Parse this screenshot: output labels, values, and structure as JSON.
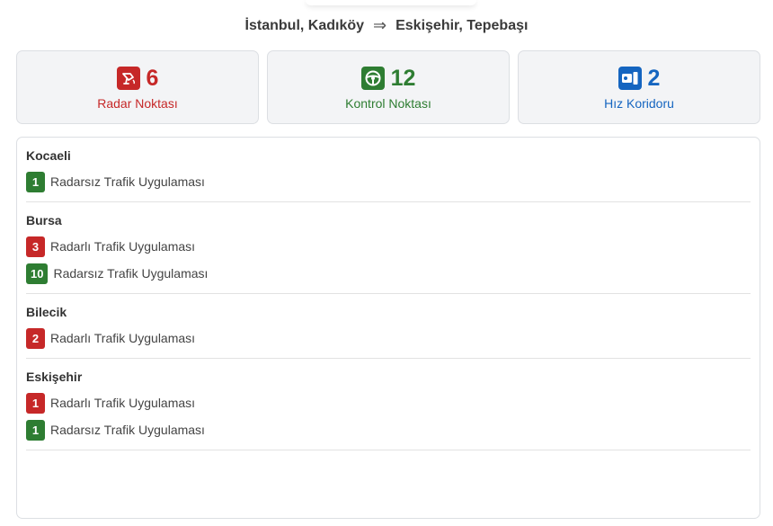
{
  "route": {
    "from": "İstanbul, Kadıköy",
    "arrow": "⇒",
    "to": "Eskişehir, Tepebaşı"
  },
  "colors": {
    "red": "#c62828",
    "green": "#2e7d32",
    "blue": "#1565c0"
  },
  "summary": [
    {
      "icon": "radar-camera-icon",
      "count": "6",
      "label": "Radar Noktası",
      "color": "red"
    },
    {
      "icon": "steering-wheel-icon",
      "count": "12",
      "label": "Kontrol Noktası",
      "color": "green"
    },
    {
      "icon": "speed-corridor-icon",
      "count": "2",
      "label": "Hız Koridoru",
      "color": "blue"
    }
  ],
  "regions": [
    {
      "name": "Kocaeli",
      "items": [
        {
          "count": "1",
          "label": "Radarsız Trafik Uygulaması",
          "color": "green"
        }
      ]
    },
    {
      "name": "Bursa",
      "items": [
        {
          "count": "3",
          "label": "Radarlı Trafik Uygulaması",
          "color": "red"
        },
        {
          "count": "10",
          "label": "Radarsız Trafik Uygulaması",
          "color": "green"
        }
      ]
    },
    {
      "name": "Bilecik",
      "items": [
        {
          "count": "2",
          "label": "Radarlı Trafik Uygulaması",
          "color": "red"
        }
      ]
    },
    {
      "name": "Eskişehir",
      "items": [
        {
          "count": "1",
          "label": "Radarlı Trafik Uygulaması",
          "color": "red"
        },
        {
          "count": "1",
          "label": "Radarsız Trafik Uygulaması",
          "color": "green"
        }
      ]
    }
  ]
}
